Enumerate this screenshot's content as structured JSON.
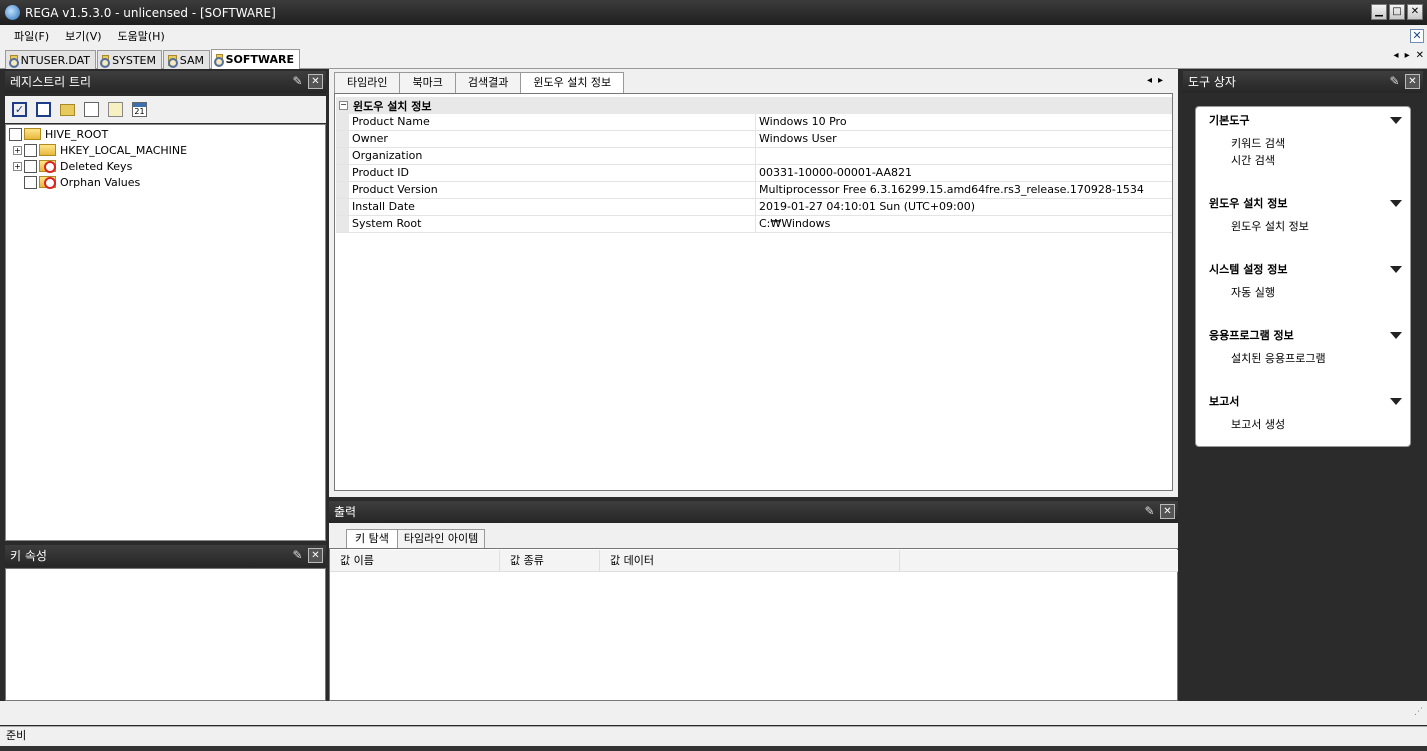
{
  "window": {
    "title": "REGA v1.5.3.0 - unlicensed - [SOFTWARE]",
    "min": "▁",
    "max": "□",
    "close": "✕"
  },
  "menu": {
    "items": [
      "파일(F)",
      "보기(V)",
      "도움말(H)"
    ],
    "close": "✕"
  },
  "doc_tabs": [
    {
      "label": "NTUSER.DAT"
    },
    {
      "label": "SYSTEM"
    },
    {
      "label": "SAM"
    },
    {
      "label": "SOFTWARE"
    }
  ],
  "doc_nav": {
    "prev": "◂",
    "next": "▸",
    "close": "✕"
  },
  "registry_tree": {
    "title": "레지스트리 트리",
    "pin": "✎",
    "close": "✕",
    "items": [
      {
        "label": "HIVE_ROOT"
      },
      {
        "label": "HKEY_LOCAL_MACHINE",
        "expander": "+"
      },
      {
        "label": "Deleted Keys",
        "expander": "+"
      },
      {
        "label": "Orphan Values"
      }
    ],
    "calendar_text": "21"
  },
  "key_props": {
    "title": "키 속성",
    "pin": "✎",
    "close": "✕"
  },
  "main_tabs": [
    {
      "label": "타임라인"
    },
    {
      "label": "북마크"
    },
    {
      "label": "검색결과"
    },
    {
      "label": "윈도우 설치 정보"
    }
  ],
  "main_tab_nav": {
    "prev": "◂",
    "next": "▸"
  },
  "install_info": {
    "group": "윈도우 설치 정보",
    "collapse": "−",
    "rows": [
      {
        "name": "Product Name",
        "value": "Windows 10 Pro"
      },
      {
        "name": "Owner",
        "value": "Windows User"
      },
      {
        "name": "Organization",
        "value": ""
      },
      {
        "name": "Product ID",
        "value": "00331-10000-00001-AA821"
      },
      {
        "name": "Product Version",
        "value": "Multiprocessor Free 6.3.16299.15.amd64fre.rs3_release.170928-1534"
      },
      {
        "name": "Install Date",
        "value": "2019-01-27  04:10:01  Sun (UTC+09:00)"
      },
      {
        "name": "System Root",
        "value": "C:₩Windows"
      }
    ]
  },
  "output": {
    "title": "출력",
    "pin": "✎",
    "close": "✕",
    "tabs": [
      {
        "label": "키 탐색"
      },
      {
        "label": "타임라인 아이템"
      }
    ],
    "columns": [
      "값 이름",
      "값 종류",
      "값 데이터"
    ]
  },
  "toolbox": {
    "title": "도구 상자",
    "pin": "✎",
    "close": "✕",
    "sections": [
      {
        "title": "기본도구",
        "links": [
          "키워드 검색",
          "시간 검색"
        ]
      },
      {
        "title": "윈도우 설치 정보",
        "links": [
          "윈도우 설치 정보"
        ]
      },
      {
        "title": "시스템 설정 정보",
        "links": [
          "자동 실행"
        ]
      },
      {
        "title": "응용프로그램 정보",
        "links": [
          "설치된 응용프로그램"
        ]
      },
      {
        "title": "보고서",
        "links": [
          "보고서 생성"
        ]
      }
    ]
  },
  "status": {
    "text": "준비"
  }
}
